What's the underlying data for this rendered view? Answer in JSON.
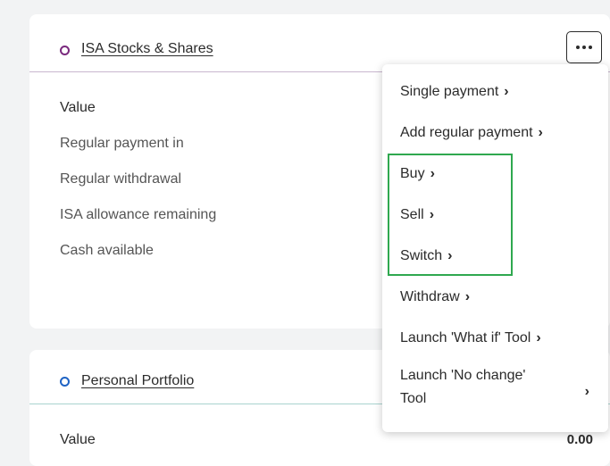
{
  "card1": {
    "title": "ISA Stocks & Shares",
    "rows": [
      {
        "label": "Value"
      },
      {
        "label": "Regular payment in"
      },
      {
        "label": "Regular withdrawal"
      },
      {
        "label": "ISA allowance remaining"
      },
      {
        "label": "Cash available"
      }
    ]
  },
  "card2": {
    "title": "Personal Portfolio",
    "value_label": "Value",
    "value": "0.00"
  },
  "menu": {
    "items": [
      {
        "label": "Single payment"
      },
      {
        "label": "Add regular payment"
      },
      {
        "label": "Buy"
      },
      {
        "label": "Sell"
      },
      {
        "label": "Switch"
      },
      {
        "label": "Withdraw"
      },
      {
        "label": "Launch 'What if' Tool"
      }
    ],
    "last_item": {
      "line1": "Launch 'No change'",
      "line2": "Tool"
    },
    "chevron": "›"
  },
  "colors": {
    "isa_ring": "#7a2a7e",
    "portfolio_ring": "#1f63c4",
    "highlight": "#2fa84f"
  },
  "icons": {
    "more": "more-horizontal-icon",
    "chevron": "chevron-right-icon"
  }
}
